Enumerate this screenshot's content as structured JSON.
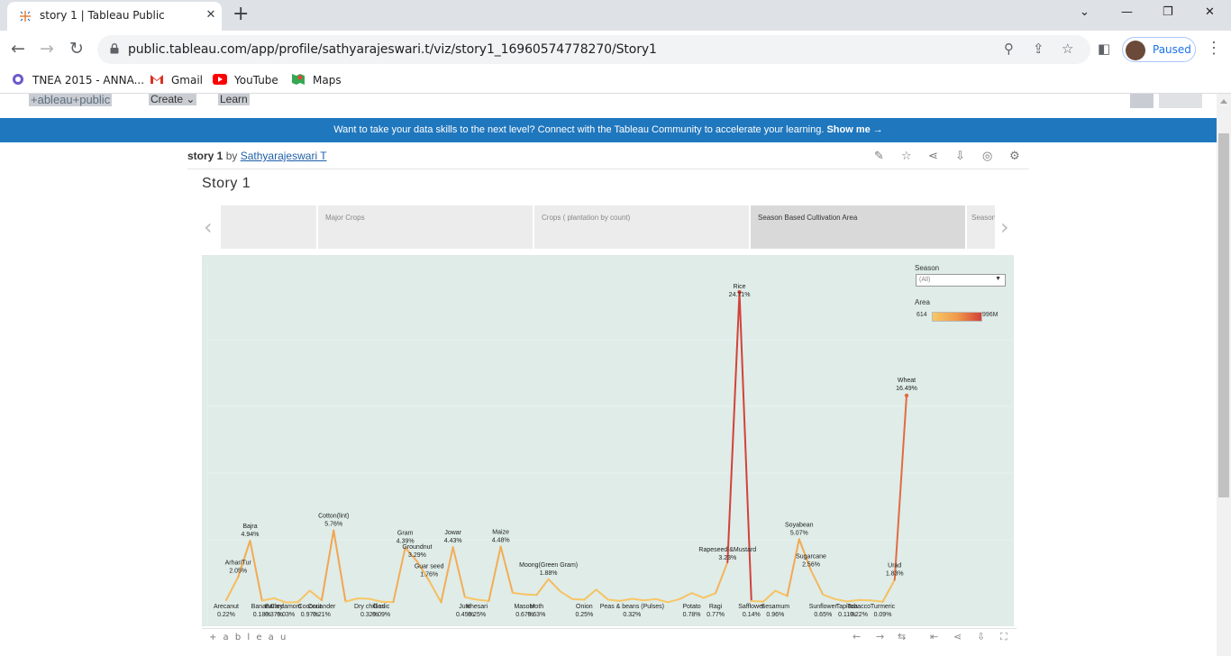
{
  "browser": {
    "tab_title": "story 1 | Tableau Public",
    "url": "public.tableau.com/app/profile/sathyarajeswari.t/viz/story1_16960574778270/Story1",
    "profile_label": "Paused",
    "bookmarks": [
      {
        "label": "TNEA 2015 - ANNA...",
        "icon": "tnea-icon"
      },
      {
        "label": "Gmail",
        "icon": "gmail-icon"
      },
      {
        "label": "YouTube",
        "icon": "youtube-icon"
      },
      {
        "label": "Maps",
        "icon": "maps-icon"
      }
    ]
  },
  "site": {
    "logo": "+ableau+public",
    "nav_create": "Create",
    "nav_learn": "Learn",
    "banner_text": "Want to take your data skills to the next level? Connect with the Tableau Community to accelerate your learning.",
    "banner_link": "Show me →"
  },
  "viz": {
    "title": "story 1",
    "by": "by",
    "author": "Sathyarajeswari T",
    "story_title": "Story 1",
    "story_points": [
      {
        "label": "",
        "active": false
      },
      {
        "label": "Major Crops",
        "active": false
      },
      {
        "label": "Crops ( plantation by count)",
        "active": false
      },
      {
        "label": "Season Based Cultivation Area",
        "active": true
      },
      {
        "label": "Season",
        "active": false
      }
    ],
    "footer_logo": "+ a b l e a u"
  },
  "filters": {
    "season_label": "Season",
    "season_value": "(All)",
    "area_label": "Area",
    "area_min": "614",
    "area_max": "996M"
  },
  "colors": {
    "low": "#f8c866",
    "mid": "#f09a4a",
    "high": "#d2413a",
    "chart_bg": "#dfece8",
    "banner": "#1f77be"
  },
  "chart_data": {
    "type": "line",
    "xlabel": "",
    "ylabel": "",
    "ylim": [
      0,
      25
    ],
    "points": [
      {
        "crop": "Arecanut",
        "value": 0.22,
        "pct": "0.22%"
      },
      {
        "crop": "Arhar/Tur",
        "value": 2.05,
        "pct": "2.05%"
      },
      {
        "crop": "Bajra",
        "value": 4.94,
        "pct": "4.94%"
      },
      {
        "crop": "Banana",
        "value": 0.18,
        "pct": "0.18%"
      },
      {
        "crop": "Barley",
        "value": 0.37,
        "pct": "0.37%"
      },
      {
        "crop": "Cardamom",
        "value": 0.03,
        "pct": "0.03%"
      },
      {
        "crop": "",
        "value": 0.05,
        "pct": ""
      },
      {
        "crop": "Coconut",
        "value": 0.97,
        "pct": "0.97%"
      },
      {
        "crop": "Coriander",
        "value": 0.21,
        "pct": "0.21%"
      },
      {
        "crop": "Cotton(lint)",
        "value": 5.76,
        "pct": "5.76%"
      },
      {
        "crop": "",
        "value": 0.1,
        "pct": ""
      },
      {
        "crop": "",
        "value": 0.35,
        "pct": ""
      },
      {
        "crop": "Dry chillies",
        "value": 0.32,
        "pct": "0.32%"
      },
      {
        "crop": "Garlic",
        "value": 0.09,
        "pct": "0.09%"
      },
      {
        "crop": "",
        "value": 0.06,
        "pct": ""
      },
      {
        "crop": "Gram",
        "value": 4.39,
        "pct": "4.39%"
      },
      {
        "crop": "Groundnut",
        "value": 3.29,
        "pct": "3.29%"
      },
      {
        "crop": "Guar seed",
        "value": 1.76,
        "pct": "1.76%"
      },
      {
        "crop": "",
        "value": 0.04,
        "pct": ""
      },
      {
        "crop": "Jowar",
        "value": 4.43,
        "pct": "4.43%"
      },
      {
        "crop": "Jute",
        "value": 0.45,
        "pct": "0.45%"
      },
      {
        "crop": "Khesari",
        "value": 0.25,
        "pct": "0.25%"
      },
      {
        "crop": "",
        "value": 0.15,
        "pct": ""
      },
      {
        "crop": "Maize",
        "value": 4.48,
        "pct": "4.48%"
      },
      {
        "crop": "",
        "value": 0.8,
        "pct": ""
      },
      {
        "crop": "Masoor",
        "value": 0.67,
        "pct": "0.67%"
      },
      {
        "crop": "Moth",
        "value": 0.63,
        "pct": "0.63%"
      },
      {
        "crop": "Moong(Green Gram)",
        "value": 1.88,
        "pct": "1.88%"
      },
      {
        "crop": "",
        "value": 0.9,
        "pct": ""
      },
      {
        "crop": "",
        "value": 0.3,
        "pct": ""
      },
      {
        "crop": "Onion",
        "value": 0.25,
        "pct": "0.25%"
      },
      {
        "crop": "",
        "value": 1.05,
        "pct": ""
      },
      {
        "crop": "",
        "value": 0.25,
        "pct": ""
      },
      {
        "crop": "",
        "value": 0.15,
        "pct": ""
      },
      {
        "crop": "Peas & beans (Pulses)",
        "value": 0.32,
        "pct": "0.32%"
      },
      {
        "crop": "",
        "value": 0.2,
        "pct": ""
      },
      {
        "crop": "",
        "value": 0.3,
        "pct": ""
      },
      {
        "crop": "",
        "value": 0.05,
        "pct": ""
      },
      {
        "crop": "",
        "value": 0.3,
        "pct": ""
      },
      {
        "crop": "Potato",
        "value": 0.78,
        "pct": "0.78%"
      },
      {
        "crop": "",
        "value": 0.4,
        "pct": ""
      },
      {
        "crop": "Ragi",
        "value": 0.77,
        "pct": "0.77%"
      },
      {
        "crop": "Rapeseed &Mustard",
        "value": 3.23,
        "pct": "3.23%"
      },
      {
        "crop": "Rice",
        "value": 24.71,
        "pct": "24.71%"
      },
      {
        "crop": "Safflower",
        "value": 0.14,
        "pct": "0.14%"
      },
      {
        "crop": "",
        "value": 0.1,
        "pct": ""
      },
      {
        "crop": "Sesamum",
        "value": 0.96,
        "pct": "0.96%"
      },
      {
        "crop": "",
        "value": 0.55,
        "pct": ""
      },
      {
        "crop": "Soyabean",
        "value": 5.07,
        "pct": "5.07%"
      },
      {
        "crop": "Sugarcane",
        "value": 2.56,
        "pct": "2.56%"
      },
      {
        "crop": "Sunflower",
        "value": 0.65,
        "pct": "0.65%"
      },
      {
        "crop": "",
        "value": 0.3,
        "pct": ""
      },
      {
        "crop": "Tapioca",
        "value": 0.11,
        "pct": "0.11%"
      },
      {
        "crop": "Tobacco",
        "value": 0.22,
        "pct": "0.22%"
      },
      {
        "crop": "",
        "value": 0.2,
        "pct": ""
      },
      {
        "crop": "Turmeric",
        "value": 0.09,
        "pct": "0.09%"
      },
      {
        "crop": "Urad",
        "value": 1.83,
        "pct": "1.83%"
      },
      {
        "crop": "Wheat",
        "value": 16.49,
        "pct": "16.49%"
      }
    ]
  }
}
